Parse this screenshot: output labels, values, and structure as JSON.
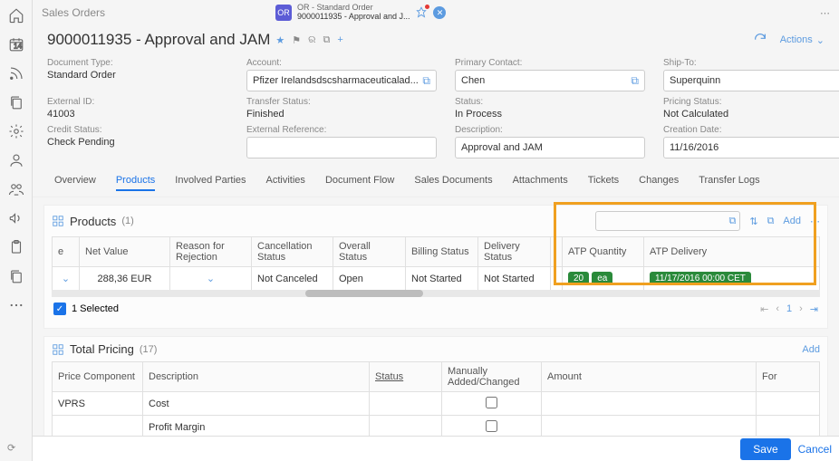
{
  "breadcrumb": "Sales Orders",
  "tab": {
    "type": "OR - Standard Order",
    "title": "9000011935 - Approval and J..."
  },
  "page": {
    "title": "9000011935 - Approval and JAM",
    "actions_label": "Actions"
  },
  "fields": {
    "doc_type_label": "Document Type:",
    "doc_type": "Standard Order",
    "account_label": "Account:",
    "account": "Pfizer Irelandsdscsharmaceuticalad...",
    "primary_contact_label": "Primary Contact:",
    "primary_contact": "Chen",
    "ship_to_label": "Ship-To:",
    "ship_to": "Superquinn",
    "external_id_label": "External ID:",
    "external_id": "41003",
    "transfer_status_label": "Transfer Status:",
    "transfer_status": "Finished",
    "status_label": "Status:",
    "status": "In Process",
    "pricing_status_label": "Pricing Status:",
    "pricing_status": "Not Calculated",
    "credit_status_label": "Credit Status:",
    "credit_status": "Check Pending",
    "external_ref_label": "External Reference:",
    "external_ref": "",
    "description_label": "Description:",
    "description": "Approval and JAM",
    "creation_date_label": "Creation Date:",
    "creation_date": "11/16/2016"
  },
  "tabs": [
    "Overview",
    "Products",
    "Involved Parties",
    "Activities",
    "Document Flow",
    "Sales Documents",
    "Attachments",
    "Tickets",
    "Changes",
    "Transfer Logs"
  ],
  "products": {
    "title": "Products",
    "count": "(1)",
    "add_label": "Add",
    "columns": [
      "e",
      "Net Value",
      "Reason for Rejection",
      "Cancellation Status",
      "Overall Status",
      "Billing Status",
      "Delivery Status",
      "",
      "ATP Quantity",
      "ATP Delivery"
    ],
    "row": {
      "net_value": "288,36 EUR",
      "cancel_status": "Not Canceled",
      "overall_status": "Open",
      "billing_status": "Not Started",
      "delivery_status": "Not Started",
      "atp_qty": "20",
      "atp_unit": "ea",
      "atp_delivery": "11/17/2016 00:00 CET"
    },
    "selected_text": "1 Selected",
    "page_num": "1"
  },
  "pricing": {
    "title": "Total Pricing",
    "count": "(17)",
    "add_label": "Add",
    "columns": [
      "Price Component",
      "Description",
      "Status",
      "Manually Added/Changed",
      "Amount",
      "For"
    ],
    "rows": [
      {
        "component": "VPRS",
        "description": "Cost"
      },
      {
        "component": "",
        "description": "Profit Margin"
      }
    ]
  },
  "footer": {
    "save": "Save",
    "cancel": "Cancel"
  },
  "rail_icons": [
    "home",
    "calendar",
    "feed",
    "copy",
    "settings",
    "user",
    "team",
    "announce",
    "clipboard",
    "copy2",
    "more"
  ]
}
